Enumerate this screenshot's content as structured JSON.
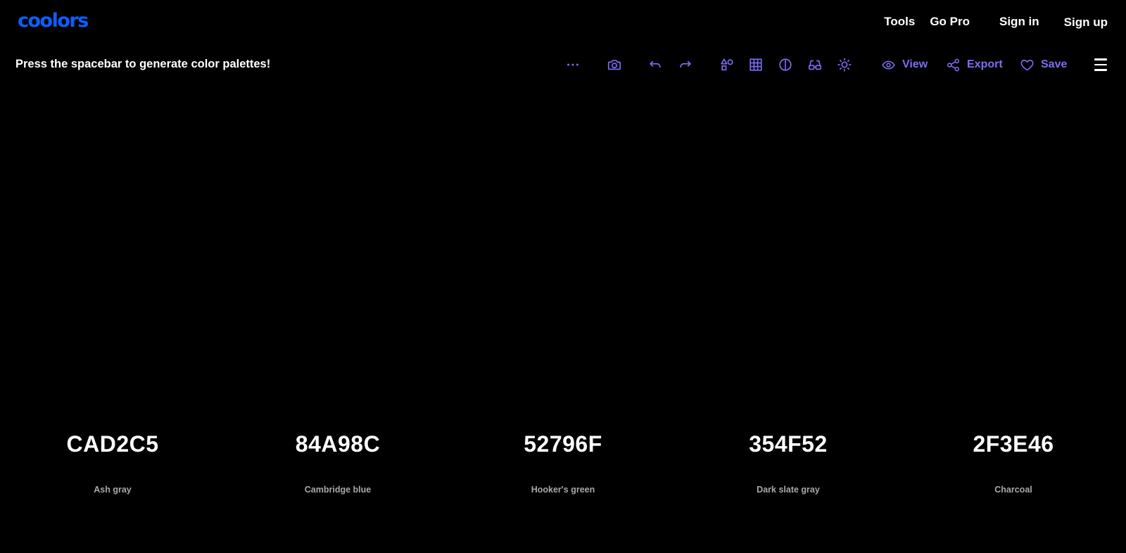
{
  "brand": {
    "logo_text": "coolors",
    "logo_color": "#0a5fff"
  },
  "nav": {
    "links": [
      "Tools",
      "Go Pro",
      "Sign in",
      "Sign up"
    ]
  },
  "toolbar": {
    "hint": "Press the spacebar to generate color palettes!",
    "accent_color": "#7b6ef6",
    "icons": [
      "more-options-icon",
      "camera-icon",
      "undo-icon",
      "redo-icon",
      "shapes-icon",
      "grid-icon",
      "contrast-icon",
      "glasses-icon",
      "sun-icon"
    ],
    "view_label": "View",
    "export_label": "Export",
    "save_label": "Save"
  },
  "palette": {
    "colors": [
      {
        "hex": "CAD2C5",
        "name": "Ash gray"
      },
      {
        "hex": "84A98C",
        "name": "Cambridge blue"
      },
      {
        "hex": "52796F",
        "name": "Hooker's green"
      },
      {
        "hex": "354F52",
        "name": "Dark slate gray"
      },
      {
        "hex": "2F3E46",
        "name": "Charcoal"
      }
    ]
  }
}
